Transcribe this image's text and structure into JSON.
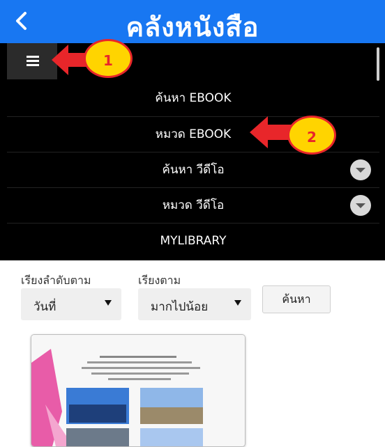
{
  "header": {
    "title": "คลังหนังสือ",
    "back_icon": "chevron-left-icon",
    "bar_color": "#1877f2"
  },
  "menu": {
    "toggle_icon": "hamburger-icon",
    "items": [
      {
        "label": "ค้นหา EBOOK",
        "has_dropdown": false
      },
      {
        "label": "หมวด EBOOK",
        "has_dropdown": false
      },
      {
        "label": "ค้นหา วีดีโอ",
        "has_dropdown": true
      },
      {
        "label": "หมวด วีดีโอ",
        "has_dropdown": true
      },
      {
        "label": "MYLIBRARY",
        "has_dropdown": false
      }
    ]
  },
  "annotations": [
    {
      "number": "1",
      "points_to": "hamburger menu button"
    },
    {
      "number": "2",
      "points_to": "หมวด EBOOK"
    }
  ],
  "filters": {
    "sort_by_label": "เรียงลำดับตาม",
    "sort_by_value": "วันที่",
    "order_label": "เรียงตาม",
    "order_value": "มากไปน้อย",
    "search_button": "ค้นหา"
  },
  "book_card": {
    "cover_image": "ebook-cover-thumbnail"
  }
}
